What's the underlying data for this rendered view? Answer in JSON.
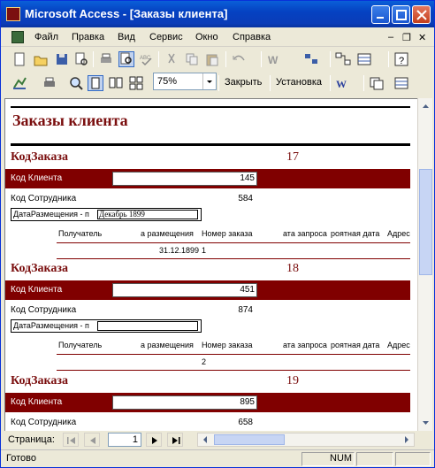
{
  "window": {
    "title": "Microsoft Access - [Заказы клиента]"
  },
  "menu": {
    "items": [
      "Файл",
      "Правка",
      "Вид",
      "Сервис",
      "Окно",
      "Справка"
    ]
  },
  "toolbar": {
    "zoom": "75%",
    "close_label": "Закрыть",
    "setup_label": "Установка"
  },
  "report": {
    "title": "Заказы клиента",
    "sections": [
      {
        "key_label": "КодЗаказа",
        "key_value": "17",
        "client_label": "Код Клиента",
        "client_value": "145",
        "emp_label": "Код Сотрудника",
        "emp_value": "584",
        "date_label": "ДатаРазмещения - п",
        "date_value": "Декабрь 1899",
        "sub_row_date": "31.12.1899",
        "sub_row_num": "1"
      },
      {
        "key_label": "КодЗаказа",
        "key_value": "18",
        "client_label": "Код Клиента",
        "client_value": "451",
        "emp_label": "Код Сотрудника",
        "emp_value": "874",
        "date_label": "ДатаРазмещения - п",
        "date_value": "",
        "sub_row_date": "",
        "sub_row_num": "2"
      },
      {
        "key_label": "КодЗаказа",
        "key_value": "19",
        "client_label": "Код Клиента",
        "client_value": "895",
        "emp_label": "Код Сотрудника",
        "emp_value": "658"
      }
    ],
    "sub_headers": [
      "Получатель",
      "а размещения",
      "Номер заказа",
      "ата запроса",
      "роятная дата",
      "Адрес"
    ]
  },
  "nav": {
    "page_label": "Страница:",
    "page_number": "1"
  },
  "status": {
    "ready": "Готово",
    "num": "NUM"
  },
  "colors": {
    "maroon": "#800000",
    "title_maroon": "#7a0e0e",
    "titlebar_blue": "#0542c2"
  }
}
